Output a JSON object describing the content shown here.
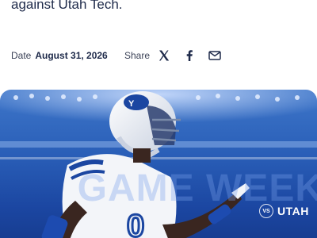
{
  "article": {
    "intro_text": "against Utah Tech."
  },
  "meta": {
    "date_label": "Date",
    "date_value": "August 31, 2026"
  },
  "share": {
    "label": "Share",
    "icons": [
      "x-icon",
      "facebook-icon",
      "email-icon"
    ]
  },
  "hero": {
    "ghost_text": "GAME WEEK",
    "vs_label": "VS",
    "opponent": "UTAH"
  },
  "colors": {
    "brand_blue": "#1b46a1",
    "text_dark": "#1e2a4a",
    "helmet_white": "#f4f6fa"
  }
}
